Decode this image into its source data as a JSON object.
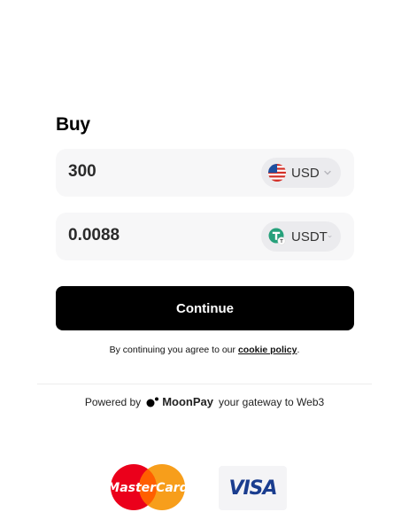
{
  "header": {
    "title": "Buy"
  },
  "pay_field": {
    "amount": "300",
    "currency": "USD",
    "currency_icon": "us-flag-icon"
  },
  "receive_field": {
    "amount": "0.0088",
    "currency": "USDT",
    "currency_icon": "tether-icon"
  },
  "continue_button": {
    "label": "Continue"
  },
  "terms": {
    "prefix": "By continuing you agree to our",
    "link": "cookie policy",
    "suffix": "."
  },
  "footer": {
    "powered_prefix": "Powered by",
    "brand": "MoonPay",
    "tagline": "your gateway to Web3"
  },
  "payment_methods": [
    {
      "name": "MasterCard",
      "icon": "mastercard-logo"
    },
    {
      "name": "VISA",
      "icon": "visa-logo"
    }
  ],
  "colors": {
    "button": "#000000",
    "field_bg": "#f7f7f8",
    "pill_bg": "#ebebee",
    "tether": "#26a17b",
    "visa_blue": "#1a3d8f"
  }
}
